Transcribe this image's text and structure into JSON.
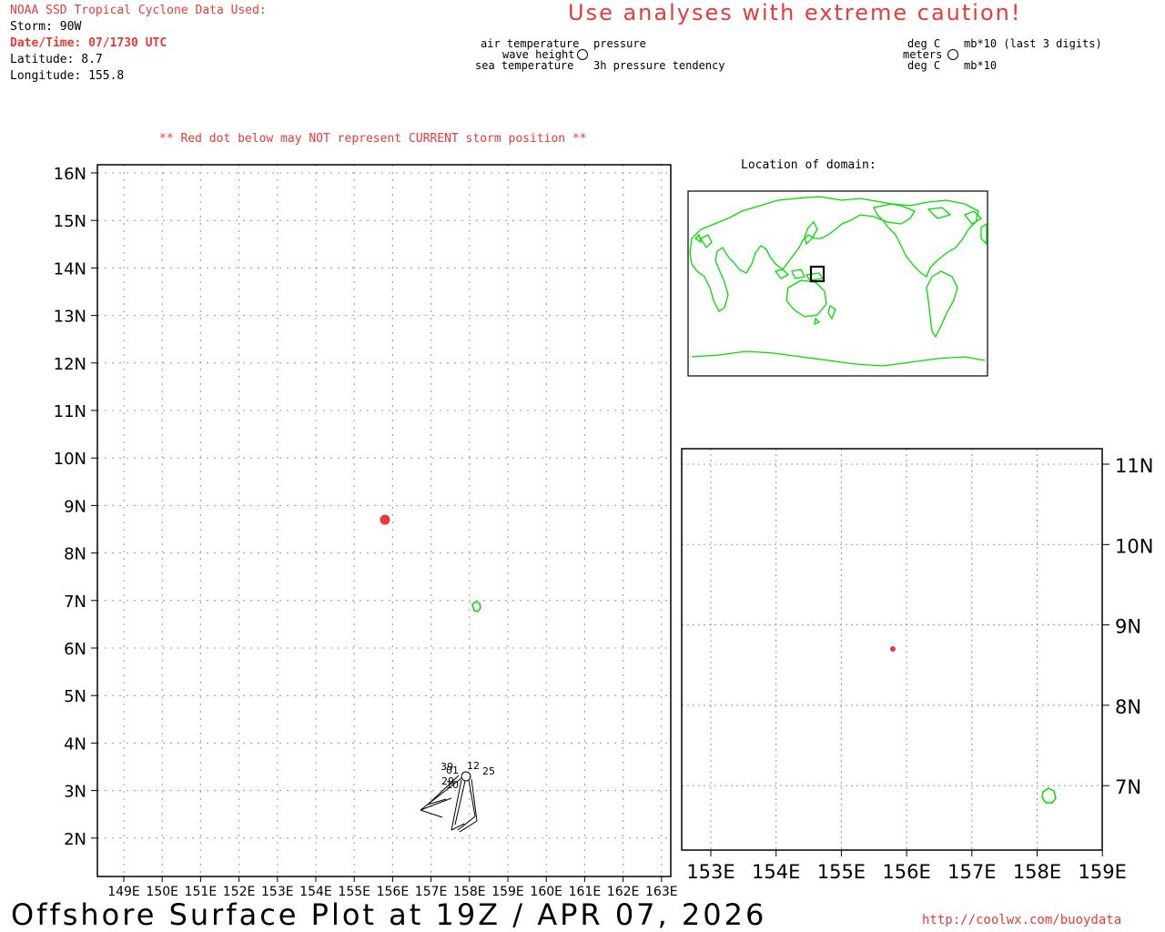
{
  "header": {
    "source_title": "NOAA SSD Tropical Cyclone Data Used:",
    "storm": "Storm: 90W",
    "datetime": "Date/Time: 07/1730 UTC",
    "latitude": "Latitude: 8.7",
    "longitude": "Longitude: 155.8",
    "caution": "Use analyses with extreme caution!"
  },
  "legend": {
    "left": {
      "air_temperature": "air temperature",
      "wave_height": "wave height",
      "sea_temperature": "sea temperature",
      "pressure": "pressure",
      "pressure_tendency": "3h pressure tendency"
    },
    "right": {
      "deg_c_top": "deg C",
      "meters": "meters",
      "deg_c_bottom": "deg C",
      "mb_last3": "mb*10 (last 3 digits)",
      "mb": "mb*10"
    }
  },
  "notes": {
    "red_dot_warning": "** Red dot below may NOT represent CURRENT storm position **",
    "location_of_domain": "Location of domain:"
  },
  "main_map": {
    "lat_labels": [
      "16N",
      "15N",
      "14N",
      "13N",
      "12N",
      "11N",
      "10N",
      "9N",
      "8N",
      "7N",
      "6N",
      "5N",
      "4N",
      "3N",
      "2N"
    ],
    "lon_labels": [
      "149E",
      "150E",
      "151E",
      "152E",
      "153E",
      "154E",
      "155E",
      "156E",
      "157E",
      "158E",
      "159E",
      "160E",
      "161E",
      "162E",
      "163E"
    ],
    "storm_position": {
      "lat": 8.7,
      "lon": 155.8
    },
    "station_cluster_labels": [
      "39",
      "01",
      "12",
      "29",
      "10",
      "25"
    ]
  },
  "zoom_map": {
    "lat_labels": [
      "11N",
      "10N",
      "9N",
      "8N",
      "7N"
    ],
    "lon_labels": [
      "153E",
      "154E",
      "155E",
      "156E",
      "157E",
      "158E",
      "159E"
    ],
    "storm_position": {
      "lat": 8.7,
      "lon": 155.8
    }
  },
  "colors": {
    "red": "#e83a3a",
    "land": "#00dd00",
    "grid": "#999999"
  },
  "footer": {
    "title": "Offshore Surface Plot at 19Z / APR 07, 2026",
    "url": "http://coolwx.com/buoydata"
  }
}
